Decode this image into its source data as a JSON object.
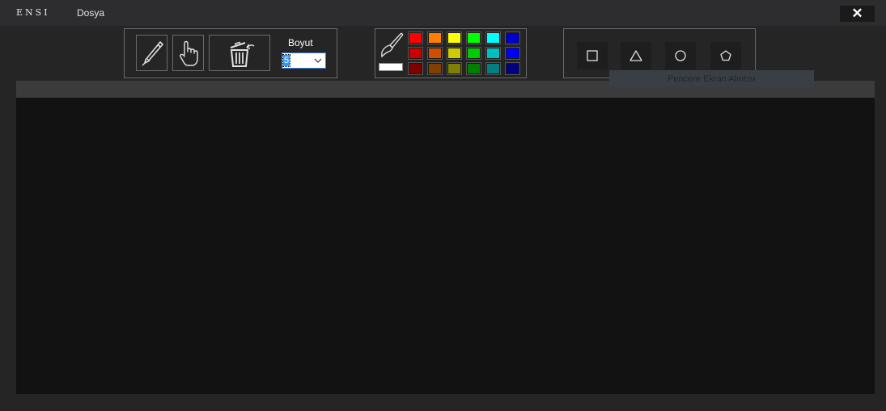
{
  "app": {
    "brand": "ENSI",
    "menu": {
      "file_label": "Dosya"
    },
    "close_symbol": "✕"
  },
  "tools": {
    "items": [
      {
        "name": "pen",
        "icon": "pen-icon"
      },
      {
        "name": "hand",
        "icon": "hand-icon"
      },
      {
        "name": "clear",
        "icon": "trash-undo-icon"
      }
    ],
    "size_label": "Boyut",
    "size_value": "5"
  },
  "palette": {
    "brush_icon": "brush-icon",
    "current_color": "#ffffff",
    "colors": [
      [
        "#ff0000",
        "#ff8000",
        "#ffff00",
        "#00ff00",
        "#00ffff",
        "#0000cc"
      ],
      [
        "#cc0000",
        "#cc5000",
        "#cccc00",
        "#00cc00",
        "#00bfbf",
        "#0000ff"
      ],
      [
        "#800000",
        "#804000",
        "#808000",
        "#008000",
        "#008080",
        "#000080"
      ]
    ]
  },
  "shapes": {
    "items": [
      {
        "name": "square",
        "icon": "square-icon"
      },
      {
        "name": "triangle",
        "icon": "triangle-icon"
      },
      {
        "name": "circle",
        "icon": "circle-icon"
      },
      {
        "name": "pentagon",
        "icon": "pentagon-icon"
      }
    ]
  },
  "tooltip": {
    "text": "Pencere Ekran Alıntısı"
  }
}
